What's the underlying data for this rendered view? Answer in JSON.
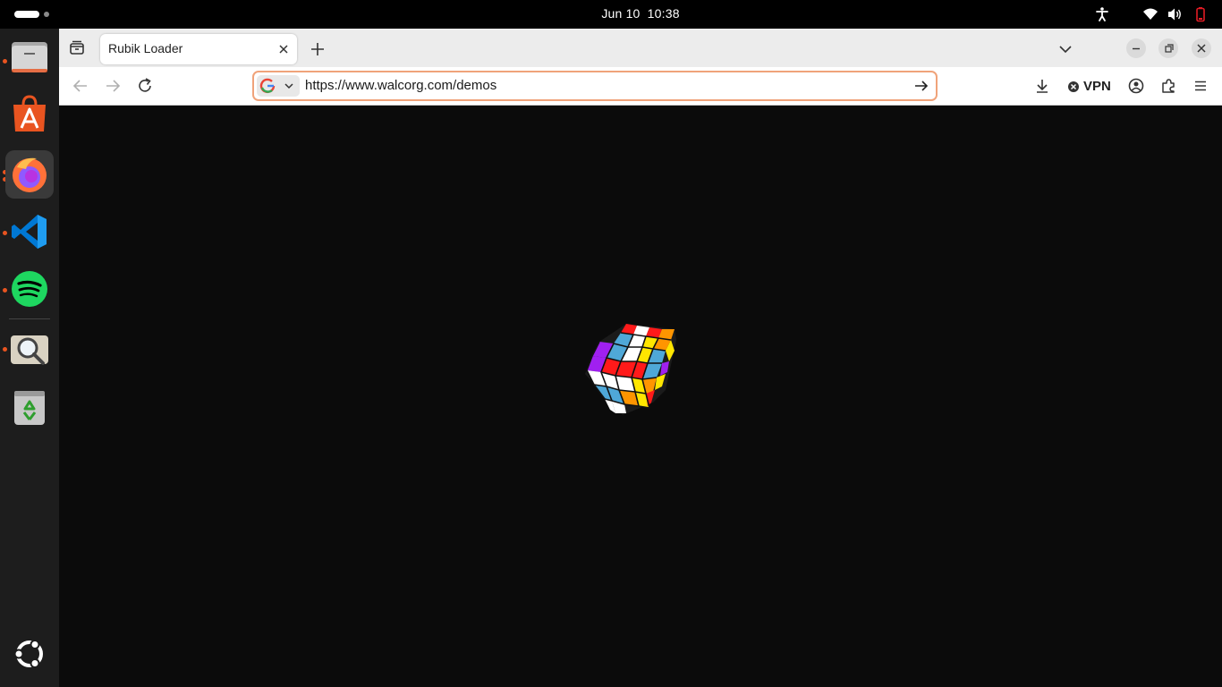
{
  "system_bar": {
    "date": "Jun 10",
    "time": "10:38",
    "tray_icons": [
      "accessibility-icon",
      "wifi-icon",
      "volume-icon",
      "power-icon"
    ]
  },
  "dock": {
    "apps": [
      {
        "name": "Files",
        "icon": "files-icon",
        "running": true,
        "active": false
      },
      {
        "name": "App Center",
        "icon": "app-center-icon",
        "running": false,
        "active": false
      },
      {
        "name": "Firefox",
        "icon": "firefox-icon",
        "running": true,
        "active": true
      },
      {
        "name": "Visual Studio Code",
        "icon": "vscode-icon",
        "running": true,
        "active": false
      },
      {
        "name": "Spotify",
        "icon": "spotify-icon",
        "running": true,
        "active": false
      },
      {
        "name": "Image Viewer",
        "icon": "image-viewer-icon",
        "running": true,
        "active": false
      },
      {
        "name": "Trash",
        "icon": "trash-icon",
        "running": false,
        "active": false
      }
    ],
    "show_apps_icon": "ubuntu-logo-icon"
  },
  "browser": {
    "tab": {
      "title": "Rubik Loader"
    },
    "url": "https://www.walcorg.com/demos",
    "search_engine_icon": "google-icon",
    "vpn_label": "VPN"
  },
  "page": {
    "content": "animated rubik's cube loader",
    "background": "#0b0b0b",
    "cube_colors": [
      "#ffffff",
      "#ff1a1a",
      "#ffe600",
      "#ff9500",
      "#4fa8d8",
      "#a020f0"
    ]
  }
}
